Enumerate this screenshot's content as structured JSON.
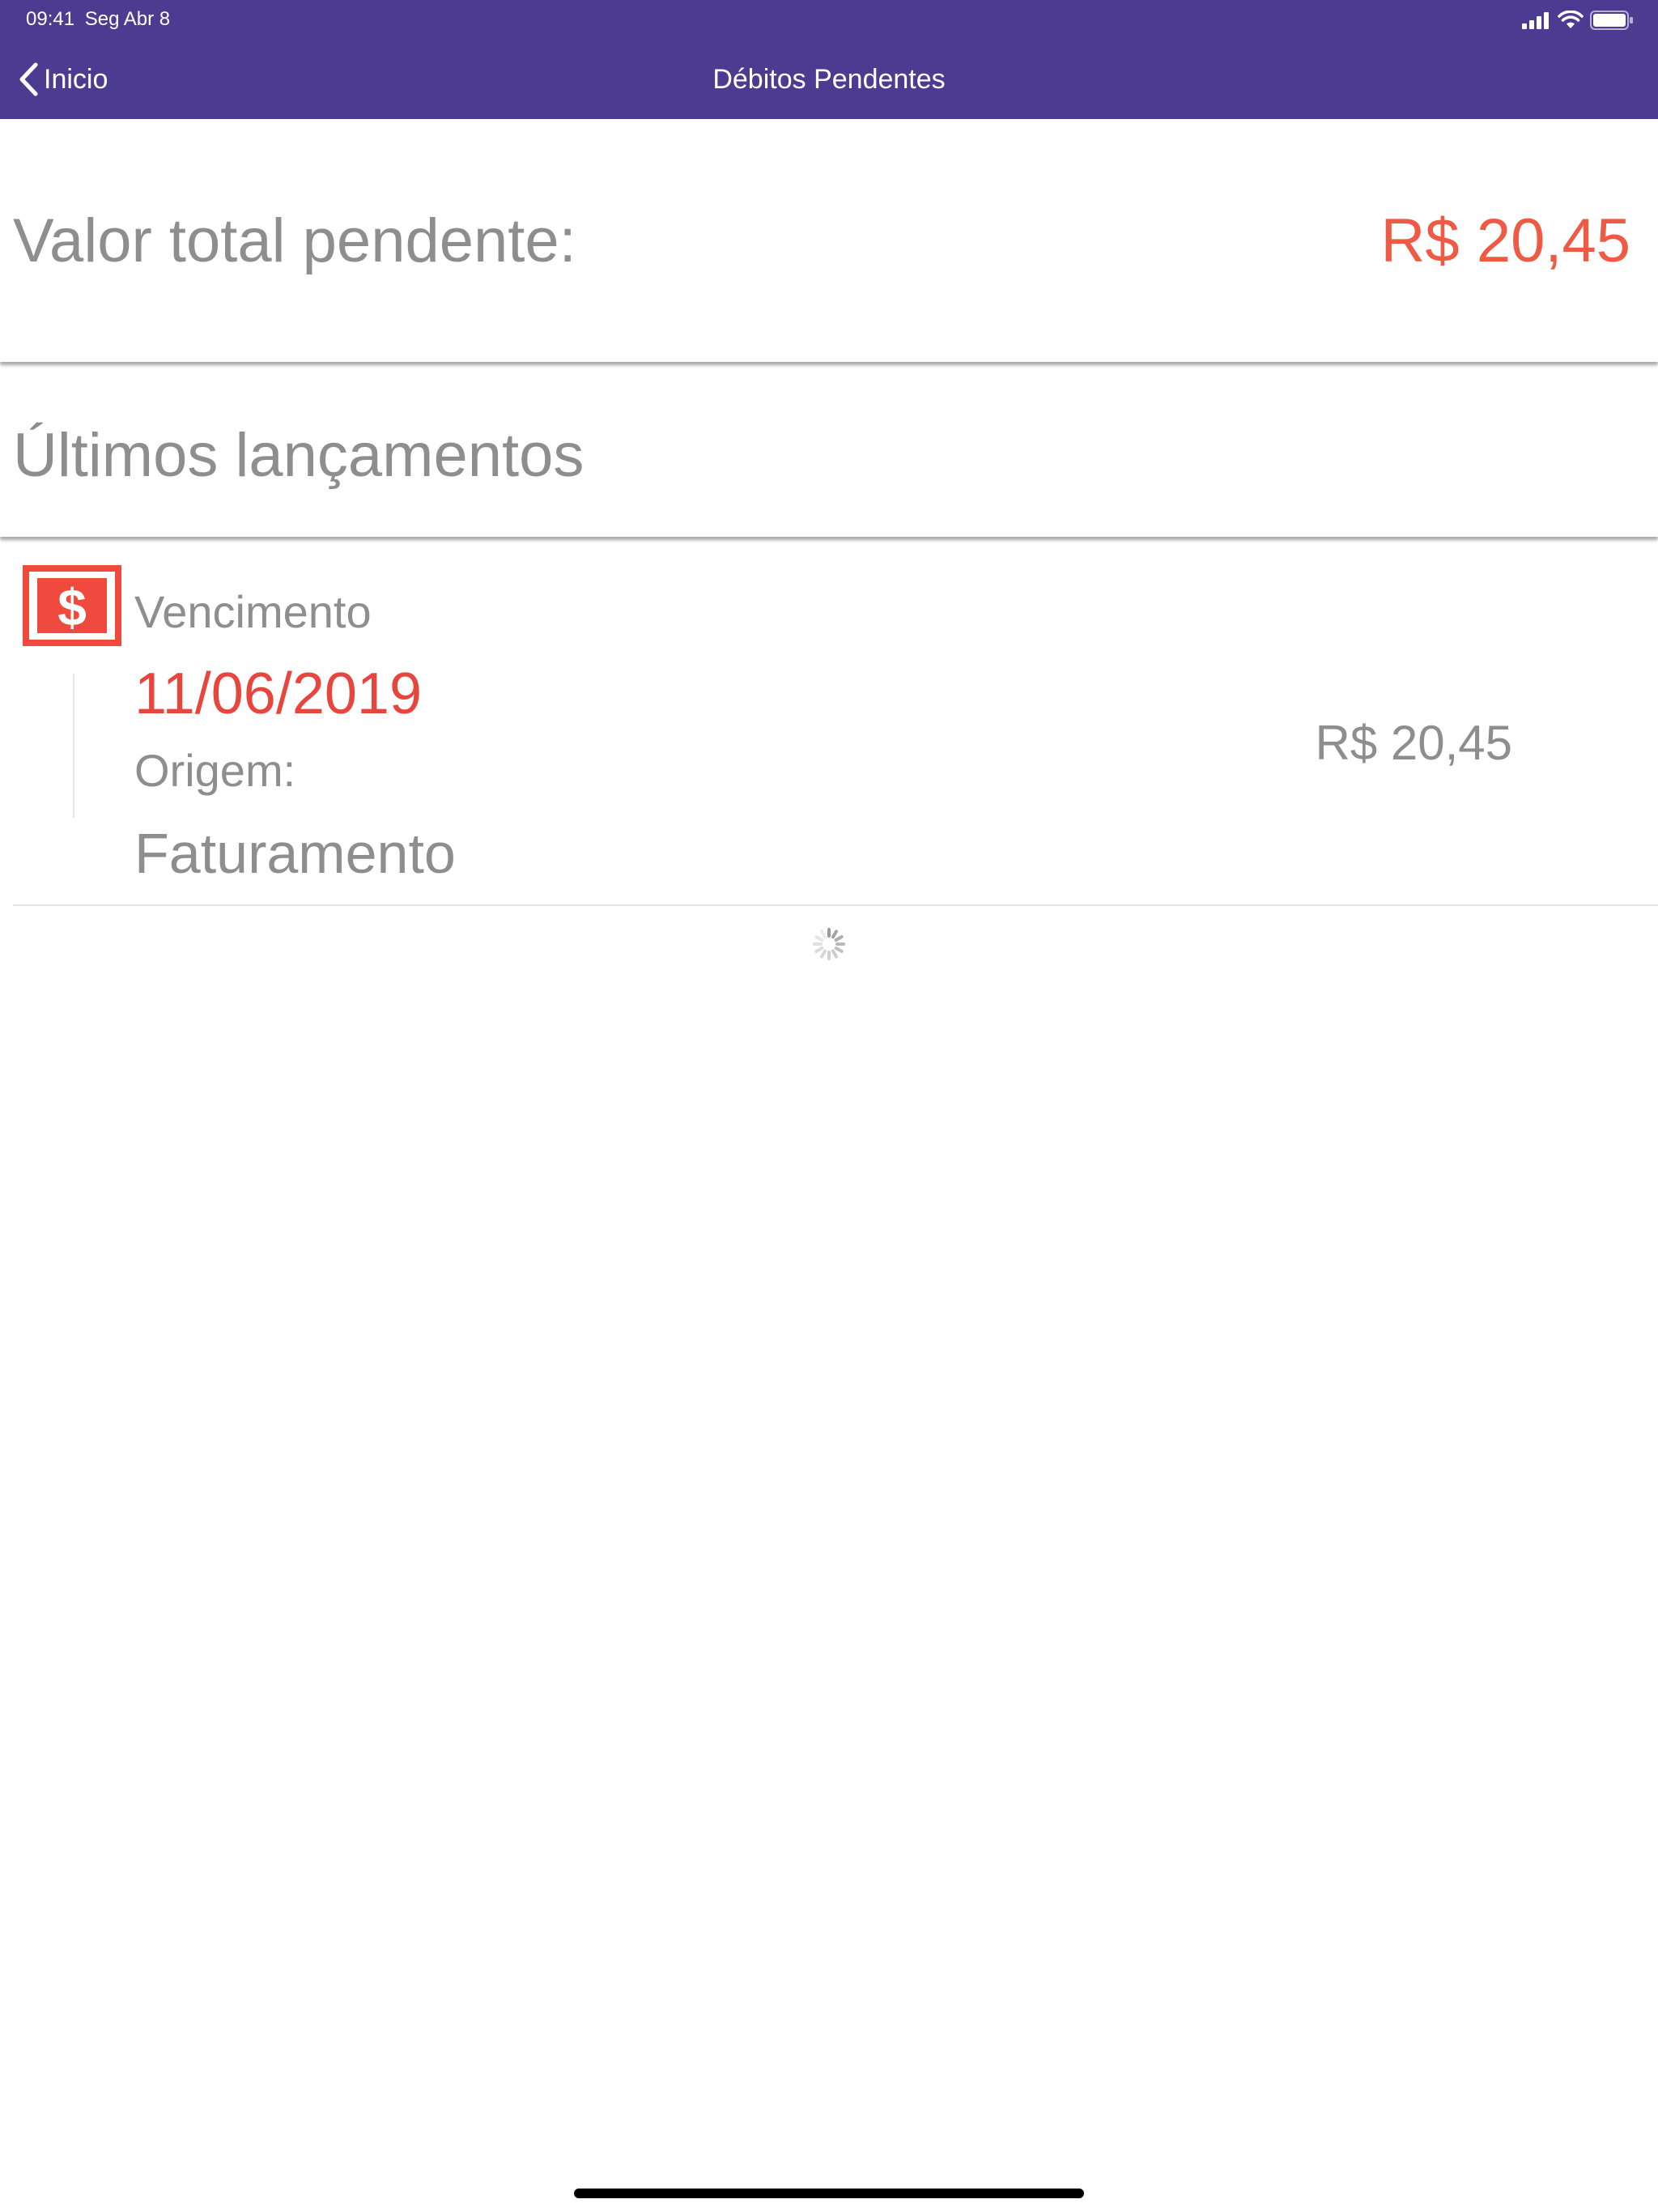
{
  "status_bar": {
    "time": "09:41",
    "date": "Seg Abr 8"
  },
  "nav": {
    "back_label": "Inicio",
    "title": "Débitos Pendentes"
  },
  "summary": {
    "label": "Valor total pendente:",
    "value": "R$ 20,45"
  },
  "section": {
    "title": "Últimos lançamentos"
  },
  "entries": [
    {
      "due_label": "Vencimento",
      "due_date": "11/06/2019",
      "origin_label": "Origem:",
      "origin_value": "Faturamento",
      "amount": "R$ 20,45",
      "icon": "dollar-bill-icon"
    }
  ],
  "colors": {
    "nav_background": "#4b3c91",
    "accent_red": "#ef5a44",
    "text_gray": "#8e8e8e"
  }
}
